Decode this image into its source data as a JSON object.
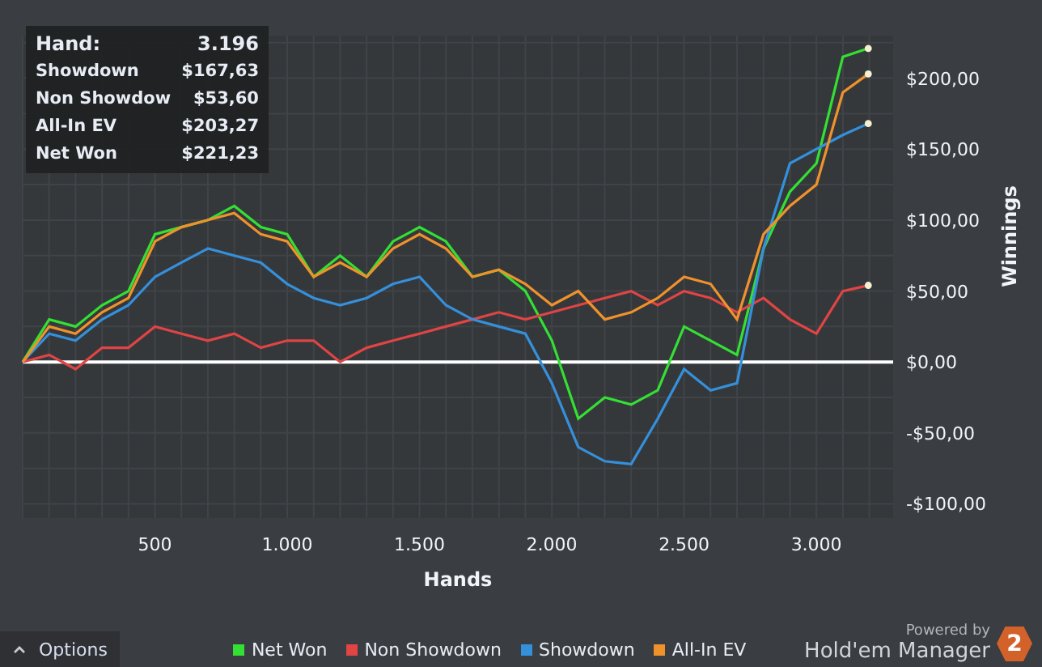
{
  "chart": {
    "chart_data": {
      "type": "line",
      "xlabel": "Hands",
      "ylabel": "Winnings",
      "grid": true,
      "x": [
        0,
        100,
        200,
        300,
        400,
        500,
        600,
        700,
        800,
        900,
        1000,
        1100,
        1200,
        1300,
        1400,
        1500,
        1600,
        1700,
        1800,
        1900,
        2000,
        2100,
        2200,
        2300,
        2400,
        2500,
        2600,
        2700,
        2800,
        2900,
        3000,
        3100,
        3196
      ],
      "series": [
        {
          "name": "Net Won",
          "color": "#33e033",
          "values": [
            0,
            30,
            25,
            40,
            50,
            90,
            95,
            100,
            110,
            95,
            90,
            60,
            75,
            60,
            85,
            95,
            85,
            60,
            65,
            50,
            15,
            -40,
            -25,
            -30,
            -20,
            25,
            15,
            5,
            80,
            120,
            140,
            215,
            221
          ]
        },
        {
          "name": "Non Showdown",
          "color": "#e04444",
          "values": [
            0,
            5,
            -5,
            10,
            10,
            25,
            20,
            15,
            20,
            10,
            15,
            15,
            0,
            10,
            15,
            20,
            25,
            30,
            35,
            30,
            35,
            40,
            45,
            50,
            40,
            50,
            45,
            35,
            45,
            30,
            20,
            50,
            54
          ]
        },
        {
          "name": "Showdown",
          "color": "#3590dc",
          "values": [
            0,
            20,
            15,
            30,
            40,
            60,
            70,
            80,
            75,
            70,
            55,
            45,
            40,
            45,
            55,
            60,
            40,
            30,
            25,
            20,
            -15,
            -60,
            -70,
            -72,
            -40,
            -5,
            -20,
            -15,
            80,
            140,
            150,
            160,
            168
          ]
        },
        {
          "name": "All-In EV",
          "color": "#f0922c",
          "values": [
            0,
            25,
            20,
            35,
            45,
            85,
            95,
            100,
            105,
            90,
            85,
            60,
            70,
            60,
            80,
            90,
            80,
            60,
            65,
            55,
            40,
            50,
            30,
            35,
            45,
            60,
            55,
            30,
            90,
            110,
            125,
            190,
            203
          ]
        }
      ],
      "xlim": [
        0,
        3290
      ],
      "ylim": [
        -110,
        230
      ],
      "xticks": [
        {
          "value": 500,
          "label": "500"
        },
        {
          "value": 1000,
          "label": "1.000"
        },
        {
          "value": 1500,
          "label": "1.500"
        },
        {
          "value": 2000,
          "label": "2.000"
        },
        {
          "value": 2500,
          "label": "2.500"
        },
        {
          "value": 3000,
          "label": "3.000"
        }
      ],
      "yticks": [
        {
          "value": -100,
          "label": "-$100,00"
        },
        {
          "value": -50,
          "label": "-$50,00"
        },
        {
          "value": 0,
          "label": "$0,00"
        },
        {
          "value": 50,
          "label": "$50,00"
        },
        {
          "value": 100,
          "label": "$100,00"
        },
        {
          "value": 150,
          "label": "$150,00"
        },
        {
          "value": 200,
          "label": "$200,00"
        }
      ]
    }
  },
  "tooltip": {
    "title": "Hand:",
    "value": "3.196",
    "rows": [
      {
        "label": "Showdown",
        "value": "$167,63"
      },
      {
        "label": "Non Showdow",
        "value": "$53,60"
      },
      {
        "label": "All-In EV",
        "value": "$203,27"
      },
      {
        "label": "Net Won",
        "value": "$221,23"
      }
    ]
  },
  "options_button": {
    "label": "Options"
  },
  "branding": {
    "powered": "Powered by",
    "product": "Hold'em Manager",
    "badge": "2"
  }
}
